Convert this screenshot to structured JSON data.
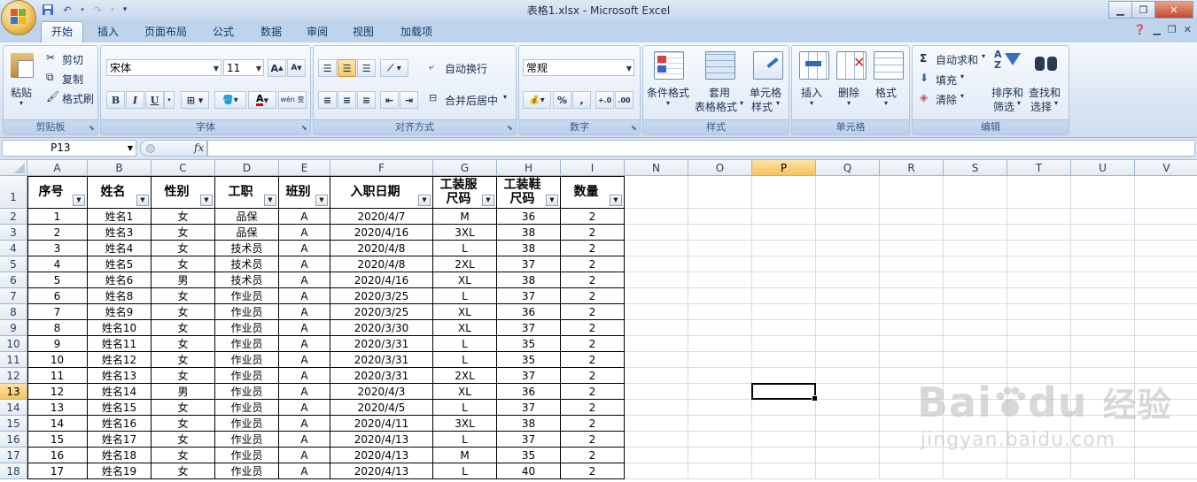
{
  "window": {
    "title": "表格1.xlsx - Microsoft Excel"
  },
  "tabs": [
    "开始",
    "插入",
    "页面布局",
    "公式",
    "数据",
    "审阅",
    "视图",
    "加载项"
  ],
  "active_tab": "开始",
  "ribbon": {
    "clipboard": {
      "label": "剪贴板",
      "paste": "粘贴",
      "cut": "剪切",
      "copy": "复制",
      "format_painter": "格式刷"
    },
    "font": {
      "label": "字体",
      "font_name": "宋体",
      "font_size": "11",
      "bold": "B",
      "italic": "I",
      "underline": "U",
      "phonetic": "wén 变"
    },
    "alignment": {
      "label": "对齐方式",
      "wrap": "自动换行",
      "merge": "合并后居中"
    },
    "number": {
      "label": "数字",
      "format": "常规",
      "percent": "%",
      "comma": ","
    },
    "styles": {
      "label": "样式",
      "cond_format": "条件格式",
      "table_format_1": "套用",
      "table_format_2": "表格格式",
      "cell_style_1": "单元格",
      "cell_style_2": "样式"
    },
    "cells": {
      "label": "单元格",
      "insert": "插入",
      "delete": "删除",
      "format": "格式"
    },
    "editing": {
      "label": "编辑",
      "autosum": "自动求和",
      "fill": "填充",
      "clear": "清除",
      "sort_1": "排序和",
      "sort_2": "筛选",
      "find_1": "查找和",
      "find_2": "选择"
    }
  },
  "formula_bar": {
    "name_box": "P13",
    "fx": "fx",
    "formula": ""
  },
  "grid": {
    "columns": [
      "A",
      "B",
      "C",
      "D",
      "E",
      "F",
      "G",
      "H",
      "I",
      "N",
      "O",
      "P",
      "Q",
      "R",
      "S",
      "T",
      "U",
      "V"
    ],
    "selected_column": "P",
    "selected_row": "13",
    "row_numbers": [
      "1",
      "2",
      "3",
      "4",
      "5",
      "6",
      "7",
      "8",
      "9",
      "10",
      "11",
      "12",
      "13",
      "14",
      "15",
      "16",
      "17",
      "18"
    ],
    "headers": [
      "序号",
      "姓名",
      "性别",
      "工职",
      "班别",
      "入职日期",
      "工装服\n尺码",
      "工装鞋\n尺码",
      "数量"
    ],
    "rows": [
      [
        "1",
        "姓名1",
        "女",
        "品保",
        "A",
        "2020/4/7",
        "M",
        "36",
        "2"
      ],
      [
        "2",
        "姓名3",
        "女",
        "品保",
        "A",
        "2020/4/16",
        "3XL",
        "38",
        "2"
      ],
      [
        "3",
        "姓名4",
        "女",
        "技术员",
        "A",
        "2020/4/8",
        "L",
        "38",
        "2"
      ],
      [
        "4",
        "姓名5",
        "女",
        "技术员",
        "A",
        "2020/4/8",
        "2XL",
        "37",
        "2"
      ],
      [
        "5",
        "姓名6",
        "男",
        "技术员",
        "A",
        "2020/4/16",
        "XL",
        "38",
        "2"
      ],
      [
        "6",
        "姓名8",
        "女",
        "作业员",
        "A",
        "2020/3/25",
        "L",
        "37",
        "2"
      ],
      [
        "7",
        "姓名9",
        "女",
        "作业员",
        "A",
        "2020/3/25",
        "XL",
        "36",
        "2"
      ],
      [
        "8",
        "姓名10",
        "女",
        "作业员",
        "A",
        "2020/3/30",
        "XL",
        "37",
        "2"
      ],
      [
        "9",
        "姓名11",
        "女",
        "作业员",
        "A",
        "2020/3/31",
        "L",
        "35",
        "2"
      ],
      [
        "10",
        "姓名12",
        "女",
        "作业员",
        "A",
        "2020/3/31",
        "L",
        "35",
        "2"
      ],
      [
        "11",
        "姓名13",
        "女",
        "作业员",
        "A",
        "2020/3/31",
        "2XL",
        "37",
        "2"
      ],
      [
        "12",
        "姓名14",
        "男",
        "作业员",
        "A",
        "2020/4/3",
        "XL",
        "36",
        "2"
      ],
      [
        "13",
        "姓名15",
        "女",
        "作业员",
        "A",
        "2020/4/5",
        "L",
        "37",
        "2"
      ],
      [
        "14",
        "姓名16",
        "女",
        "作业员",
        "A",
        "2020/4/11",
        "3XL",
        "38",
        "2"
      ],
      [
        "15",
        "姓名17",
        "女",
        "作业员",
        "A",
        "2020/4/13",
        "L",
        "37",
        "2"
      ],
      [
        "16",
        "姓名18",
        "女",
        "作业员",
        "A",
        "2020/4/13",
        "M",
        "35",
        "2"
      ],
      [
        "17",
        "姓名19",
        "女",
        "作业员",
        "A",
        "2020/4/13",
        "L",
        "40",
        "2"
      ]
    ]
  },
  "watermark": {
    "brand": "Bai",
    "brand2": "du",
    "cn": "经验",
    "url": "jingyan.baidu.com"
  },
  "colors": {
    "accent": "#f6c35c",
    "ribbon": "#dbe5f1",
    "grid_line": "#d4dce6"
  }
}
